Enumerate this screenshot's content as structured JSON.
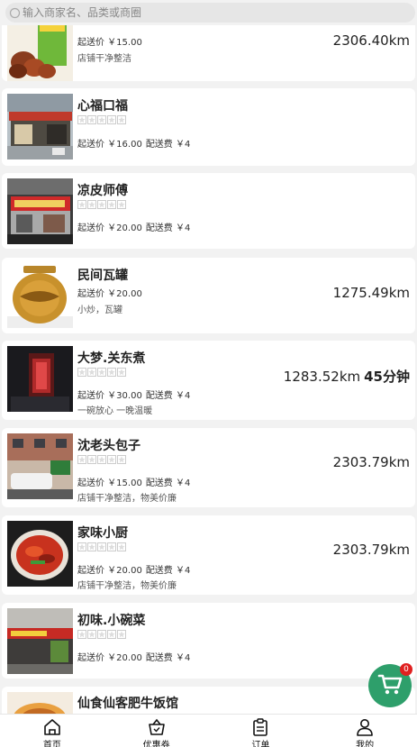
{
  "search": {
    "placeholder": "输入商家名、品类或商圈",
    "icon": "search-icon"
  },
  "shops": [
    {
      "name": "",
      "min_order": "起送价 ￥15.00",
      "delivery_fee": "",
      "desc": "店铺干净整洁",
      "distance": "2306.40km",
      "time": "",
      "thumb": "snack-products"
    },
    {
      "name": "心福口福",
      "min_order": "起送价 ￥16.00",
      "delivery_fee": "配送费 ￥4",
      "desc": "",
      "distance": "",
      "time": "",
      "thumb": "storefront"
    },
    {
      "name": "凉皮师傅",
      "min_order": "起送价 ￥20.00",
      "delivery_fee": "配送费 ￥4",
      "desc": "",
      "distance": "",
      "time": "",
      "thumb": "storefront-red"
    },
    {
      "name": "民间瓦罐",
      "min_order": "起送价 ￥20.00",
      "delivery_fee": "",
      "desc": "小炒，瓦罐",
      "distance": "1275.49km",
      "time": "",
      "thumb": "clay-pot"
    },
    {
      "name": "大梦.关东煮",
      "min_order": "起送价 ￥30.00",
      "delivery_fee": "配送费 ￥4",
      "desc": "一碗放心 一晚温暖",
      "distance": "1283.52km",
      "time": "45分钟",
      "thumb": "dark-interior"
    },
    {
      "name": "沈老头包子",
      "min_order": "起送价 ￥15.00",
      "delivery_fee": "配送费 ￥4",
      "desc": "店铺干净整洁，物美价廉",
      "distance": "2303.79km",
      "time": "",
      "thumb": "street-building"
    },
    {
      "name": "家味小厨",
      "min_order": "起送价 ￥20.00",
      "delivery_fee": "配送费 ￥4",
      "desc": "店铺干净整洁，物美价廉",
      "distance": "2303.79km",
      "time": "",
      "thumb": "spicy-dish"
    },
    {
      "name": "初味.小碗菜",
      "min_order": "起送价 ￥20.00",
      "delivery_fee": "配送费 ￥4",
      "desc": "",
      "distance": "",
      "time": "",
      "thumb": "street-shop"
    },
    {
      "name": "仙食仙客肥牛饭馆",
      "min_order": "",
      "delivery_fee": "",
      "desc": "",
      "distance": "",
      "time": "",
      "thumb": "beef-rice"
    }
  ],
  "cart": {
    "count": "0",
    "icon": "cart-icon",
    "color": "#2e9f6b"
  },
  "tabbar": [
    {
      "label": "首页",
      "icon": "home-icon"
    },
    {
      "label": "优惠券",
      "icon": "coupon-basket-icon"
    },
    {
      "label": "订单",
      "icon": "clipboard-icon"
    },
    {
      "label": "我的",
      "icon": "user-icon"
    }
  ]
}
